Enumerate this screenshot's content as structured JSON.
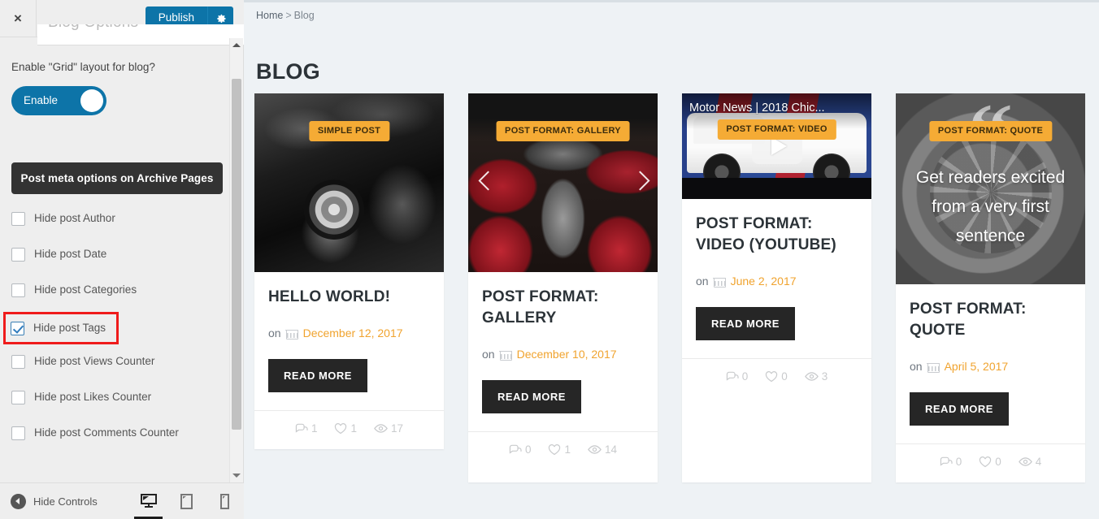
{
  "customizer": {
    "close_label": "×",
    "publish_label": "Publish",
    "gear_icon": "gear-icon",
    "section_title": "Blog Options",
    "grid_question": "Enable \"Grid\" layout for blog?",
    "toggle_label": "Enable",
    "toggle_state": "on",
    "group_header": "Post meta options on Archive Pages",
    "checkboxes": [
      {
        "label": "Hide post Author",
        "checked": false,
        "highlighted": false
      },
      {
        "label": "Hide post Date",
        "checked": false,
        "highlighted": false
      },
      {
        "label": "Hide post Categories",
        "checked": false,
        "highlighted": false
      },
      {
        "label": "Hide post Tags",
        "checked": true,
        "highlighted": true
      },
      {
        "label": "Hide post Views Counter",
        "checked": false,
        "highlighted": false
      },
      {
        "label": "Hide post Likes Counter",
        "checked": false,
        "highlighted": false
      },
      {
        "label": "Hide post Comments Counter",
        "checked": false,
        "highlighted": false
      }
    ],
    "footer": {
      "hide_controls_label": "Hide Controls",
      "devices": [
        {
          "name": "desktop",
          "active": true
        },
        {
          "name": "tablet",
          "active": false
        },
        {
          "name": "mobile",
          "active": false
        }
      ]
    },
    "colors": {
      "publish_blue": "#0d74a8",
      "highlight_red": "#ef1b1b",
      "group_dark": "#333333"
    }
  },
  "preview": {
    "breadcrumb": {
      "home": "Home",
      "separator": ">",
      "current": "Blog"
    },
    "page_title": "BLOG",
    "colors": {
      "badge_orange": "#f5ab35",
      "date_orange": "#f0a32e",
      "button_dark": "#262626"
    },
    "posts": [
      {
        "badge": "SIMPLE POST",
        "title": "HELLO WORLD!",
        "meta_prefix": "on",
        "date": "December 12, 2017",
        "read_more": "READ MORE",
        "comments": "1",
        "likes": "1",
        "views": "17"
      },
      {
        "badge": "POST FORMAT: GALLERY",
        "title": "POST FORMAT: GALLERY",
        "meta_prefix": "on",
        "date": "December 10, 2017",
        "read_more": "READ MORE",
        "comments": "0",
        "likes": "1",
        "views": "14"
      },
      {
        "badge": "POST FORMAT: VIDEO",
        "video_title": "Motor News | 2018 Chic...",
        "title": "POST FORMAT: VIDEO (YOUTUBE)",
        "meta_prefix": "on",
        "date": "June 2, 2017",
        "read_more": "READ MORE",
        "comments": "0",
        "likes": "0",
        "views": "3"
      },
      {
        "badge": "POST FORMAT: QUOTE",
        "quote": "Get readers excited from a very first sentence",
        "title": "POST FORMAT: QUOTE",
        "meta_prefix": "on",
        "date": "April 5, 2017",
        "read_more": "READ MORE",
        "comments": "0",
        "likes": "0",
        "views": "4"
      }
    ]
  }
}
